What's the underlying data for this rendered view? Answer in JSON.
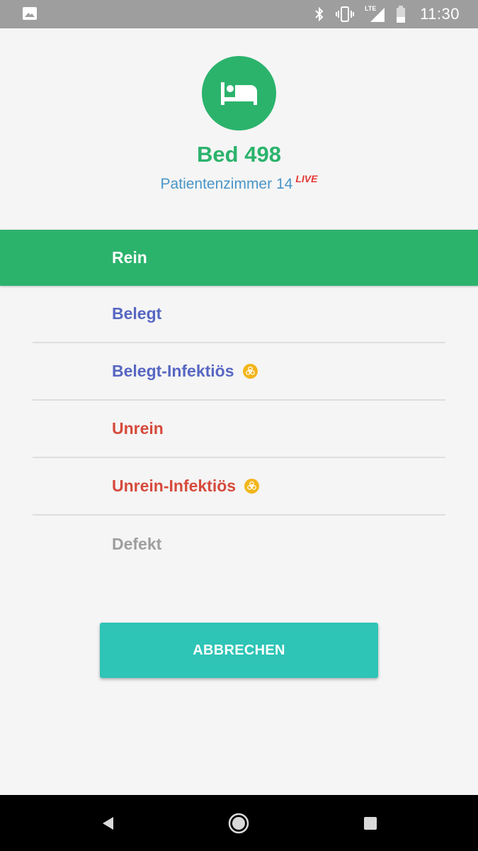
{
  "status_bar": {
    "time": "11:30",
    "network": "LTE",
    "icons": [
      "image-icon",
      "bluetooth-icon",
      "vibrate-icon",
      "lte-signal-icon",
      "battery-icon"
    ]
  },
  "header": {
    "icon": "bed-icon",
    "title": "Bed 498",
    "subtitle": "Patientenzimmer 14",
    "live_badge": "LIVE"
  },
  "selected": {
    "label": "Rein"
  },
  "options": [
    {
      "label": "Belegt",
      "infectious": false,
      "color": "#5767c2"
    },
    {
      "label": "Belegt-Infektiös",
      "infectious": true,
      "color": "#5767c2"
    },
    {
      "label": "Unrein",
      "infectious": false,
      "color": "#d64a3c"
    },
    {
      "label": "Unrein-Infektiös",
      "infectious": true,
      "color": "#d64a3c"
    },
    {
      "label": "Defekt",
      "infectious": false,
      "color": "#9e9e9e"
    }
  ],
  "cancel_button": {
    "label": "ABBRECHEN"
  },
  "nav_bar": {
    "buttons": [
      "back-icon",
      "home-icon",
      "recents-icon"
    ]
  },
  "colors": {
    "green": "#2bb36c",
    "teal": "#2ec4b6",
    "subtitle_blue": "#4a95c7",
    "live_red": "#e53935",
    "biohazard_yellow": "#f2b51b"
  }
}
